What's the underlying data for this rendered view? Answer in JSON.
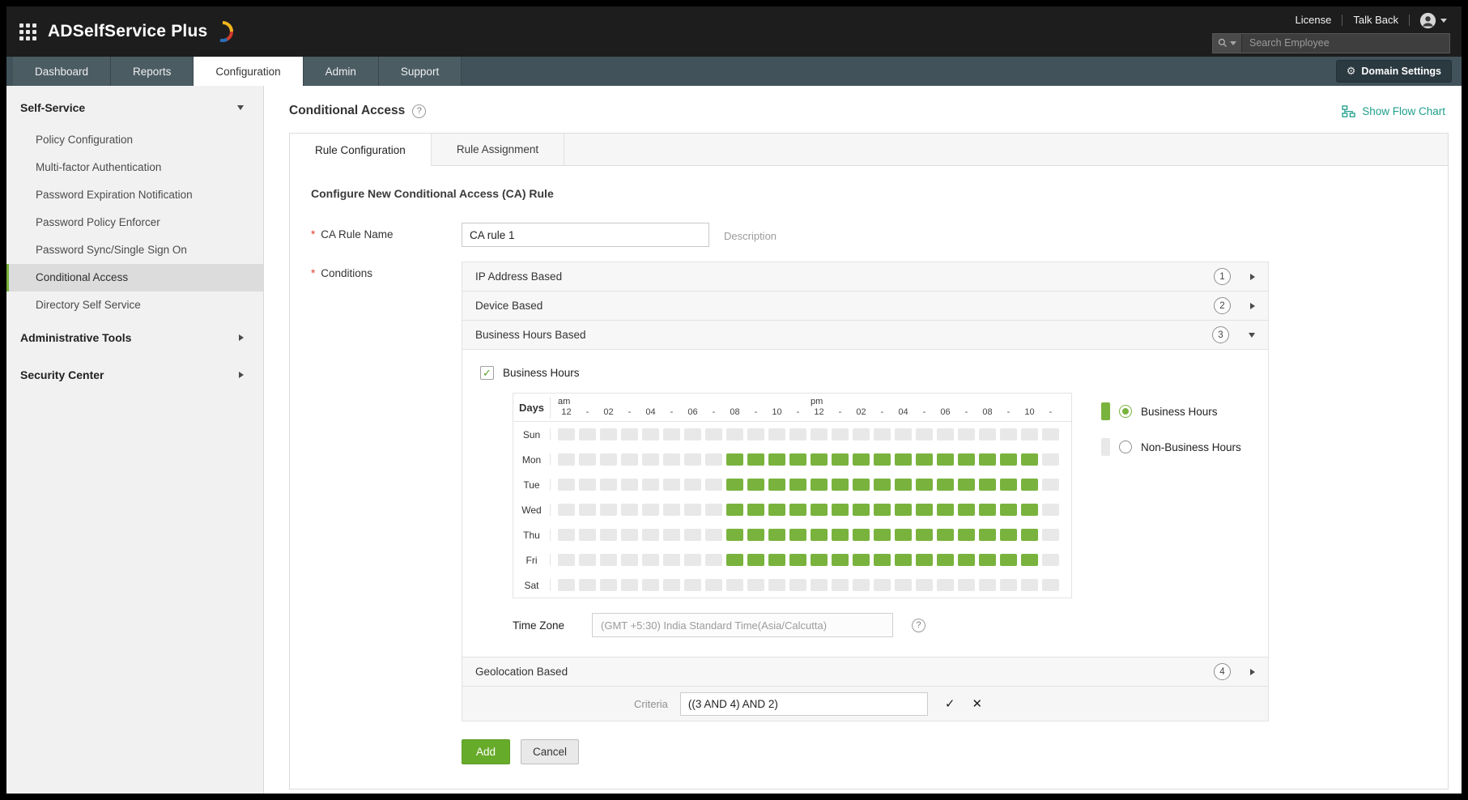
{
  "colors": {
    "accent_green": "#79b33e",
    "add_button_green": "#67ab2a",
    "flow_link_teal": "#1e9e8a",
    "cell_off_gray": "#e8e8e8"
  },
  "topbar": {
    "brand": "ADSelfService Plus",
    "license": "License",
    "talkback": "Talk Back",
    "search_placeholder": "Search Employee"
  },
  "nav": {
    "items": [
      {
        "label": "Dashboard",
        "active": false
      },
      {
        "label": "Reports",
        "active": false
      },
      {
        "label": "Configuration",
        "active": true
      },
      {
        "label": "Admin",
        "active": false
      },
      {
        "label": "Support",
        "active": false
      }
    ],
    "domain_settings": "Domain Settings"
  },
  "sidebar": {
    "sections": [
      {
        "label": "Self-Service",
        "expanded": true,
        "items": [
          "Policy Configuration",
          "Multi-factor Authentication",
          "Password Expiration Notification",
          "Password Policy Enforcer",
          "Password Sync/Single Sign On",
          "Conditional Access",
          "Directory Self Service"
        ],
        "selected": "Conditional Access"
      },
      {
        "label": "Administrative Tools",
        "expanded": false
      },
      {
        "label": "Security Center",
        "expanded": false
      }
    ]
  },
  "main": {
    "title": "Conditional Access",
    "flow_chart": "Show Flow Chart",
    "tabs": [
      {
        "label": "Rule Configuration",
        "active": true
      },
      {
        "label": "Rule Assignment",
        "active": false
      }
    ],
    "section_heading": "Configure New Conditional Access (CA) Rule",
    "ca_rule_name": {
      "label": "CA Rule Name",
      "value": "CA rule 1",
      "description_link": "Description"
    },
    "conditions": {
      "label": "Conditions",
      "accordions": [
        {
          "label": "IP Address Based",
          "badge": "1",
          "expanded": false
        },
        {
          "label": "Device Based",
          "badge": "2",
          "expanded": false
        },
        {
          "label": "Business Hours Based",
          "badge": "3",
          "expanded": true
        },
        {
          "label": "Geolocation Based",
          "badge": "4",
          "expanded": false
        }
      ],
      "business_hours": {
        "checkbox_label": "Business Hours",
        "checked": true,
        "days_header": "Days",
        "am_label": "am",
        "pm_label": "pm",
        "hour_labels": [
          "12",
          "-",
          "02",
          "-",
          "04",
          "-",
          "06",
          "-",
          "08",
          "-",
          "10",
          "-"
        ],
        "rows": [
          {
            "day": "Sun",
            "hours": [
              0,
              0,
              0,
              0,
              0,
              0,
              0,
              0,
              0,
              0,
              0,
              0,
              0,
              0,
              0,
              0,
              0,
              0,
              0,
              0,
              0,
              0,
              0,
              0
            ]
          },
          {
            "day": "Mon",
            "hours": [
              0,
              0,
              0,
              0,
              0,
              0,
              0,
              0,
              1,
              1,
              1,
              1,
              1,
              1,
              1,
              1,
              1,
              1,
              1,
              1,
              1,
              1,
              1,
              0
            ]
          },
          {
            "day": "Tue",
            "hours": [
              0,
              0,
              0,
              0,
              0,
              0,
              0,
              0,
              1,
              1,
              1,
              1,
              1,
              1,
              1,
              1,
              1,
              1,
              1,
              1,
              1,
              1,
              1,
              0
            ]
          },
          {
            "day": "Wed",
            "hours": [
              0,
              0,
              0,
              0,
              0,
              0,
              0,
              0,
              1,
              1,
              1,
              1,
              1,
              1,
              1,
              1,
              1,
              1,
              1,
              1,
              1,
              1,
              1,
              0
            ]
          },
          {
            "day": "Thu",
            "hours": [
              0,
              0,
              0,
              0,
              0,
              0,
              0,
              0,
              1,
              1,
              1,
              1,
              1,
              1,
              1,
              1,
              1,
              1,
              1,
              1,
              1,
              1,
              1,
              0
            ]
          },
          {
            "day": "Fri",
            "hours": [
              0,
              0,
              0,
              0,
              0,
              0,
              0,
              0,
              1,
              1,
              1,
              1,
              1,
              1,
              1,
              1,
              1,
              1,
              1,
              1,
              1,
              1,
              1,
              0
            ]
          },
          {
            "day": "Sat",
            "hours": [
              0,
              0,
              0,
              0,
              0,
              0,
              0,
              0,
              0,
              0,
              0,
              0,
              0,
              0,
              0,
              0,
              0,
              0,
              0,
              0,
              0,
              0,
              0,
              0
            ]
          }
        ],
        "legend": [
          {
            "label": "Business Hours",
            "selected": true
          },
          {
            "label": "Non-Business Hours",
            "selected": false
          }
        ],
        "timezone_label": "Time Zone",
        "timezone_value": "(GMT +5:30) India Standard Time(Asia/Calcutta)"
      },
      "criteria": {
        "label": "Criteria",
        "value": "((3 AND 4) AND 2)"
      }
    },
    "buttons": {
      "add": "Add",
      "cancel": "Cancel"
    }
  }
}
